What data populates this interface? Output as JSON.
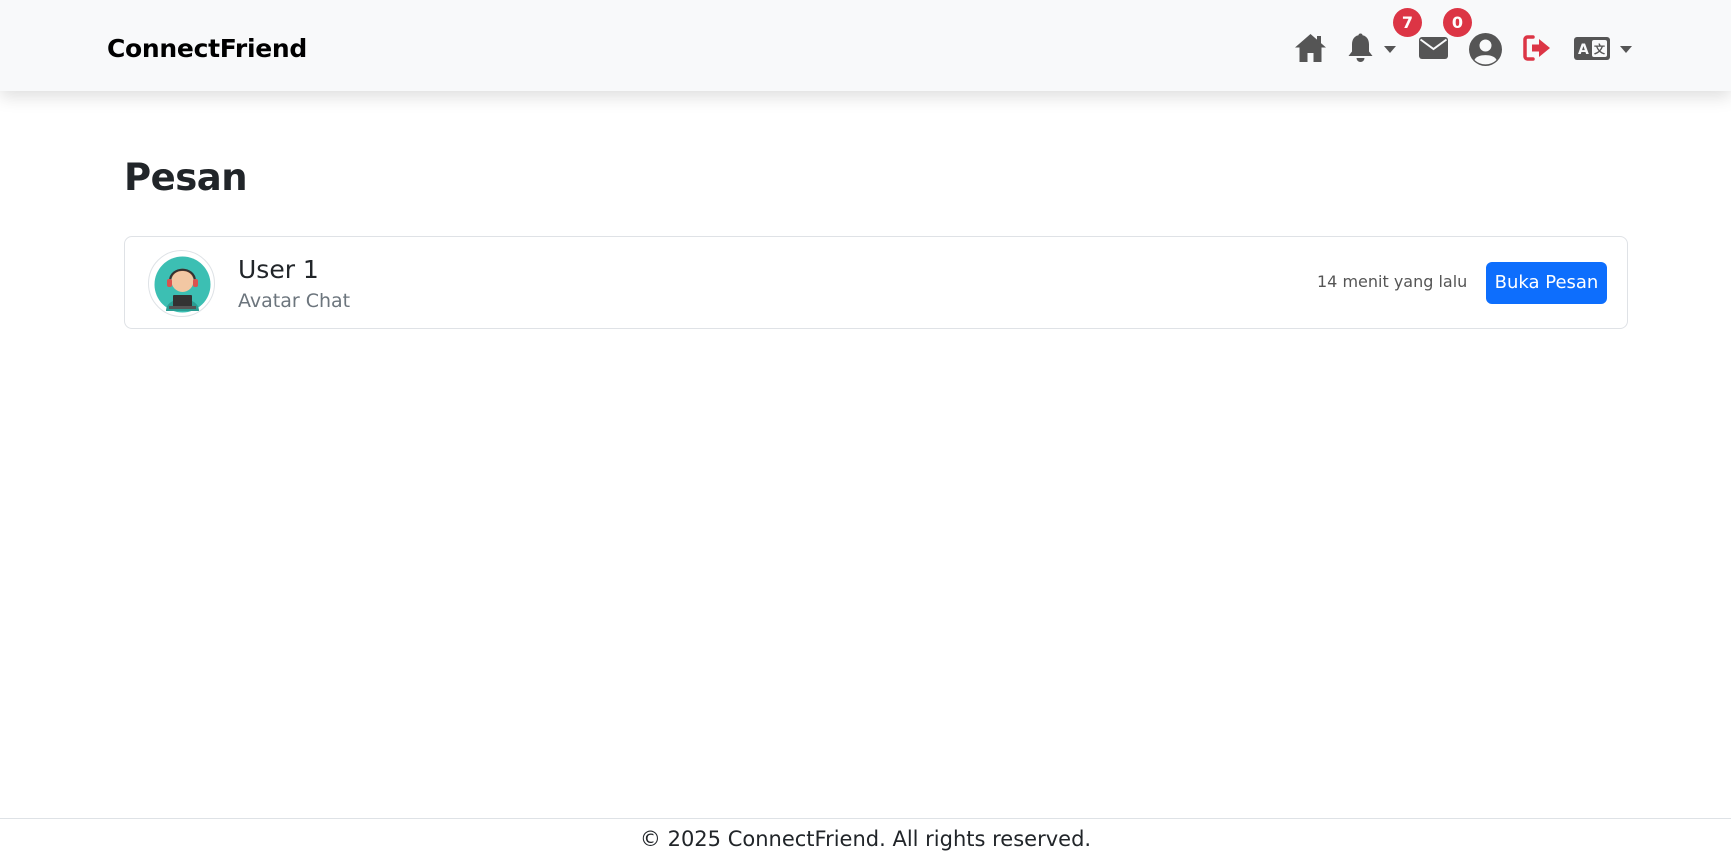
{
  "navbar": {
    "brand": "ConnectFriend",
    "icons": {
      "home": "home-icon",
      "notifications": "bell-icon",
      "messages": "envelope-icon",
      "profile": "user-circle-icon",
      "logout": "logout-icon",
      "language": "language-icon"
    },
    "notifications_count": "7",
    "messages_count": "0"
  },
  "page": {
    "title": "Pesan"
  },
  "messages": [
    {
      "name": "User 1",
      "subtitle": "Avatar Chat",
      "time": "14 menit yang lalu",
      "button_label": "Buka Pesan"
    }
  ],
  "footer": {
    "text": "© 2025 ConnectFriend. All rights reserved."
  },
  "colors": {
    "primary": "#0d6efd",
    "danger": "#dc3545",
    "navbar_bg": "#f8f9fa",
    "icon": "#555555"
  }
}
